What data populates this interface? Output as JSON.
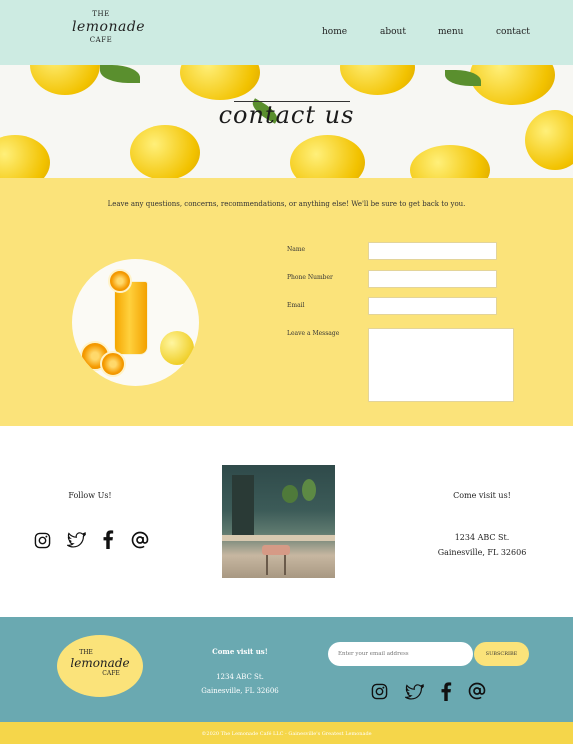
{
  "brand": {
    "the": "THE",
    "name": "lemonade",
    "cafe": "CAFE"
  },
  "nav": {
    "items": [
      "home",
      "about",
      "menu",
      "contact"
    ]
  },
  "hero": {
    "title": "contact us"
  },
  "contact": {
    "intro": "Leave any questions, concerns, recommendations, or anything else! We'll be sure to get back to you.",
    "fields": {
      "name_label": "Name",
      "phone_label": "Phone Number",
      "email_label": "Email",
      "message_label": "Leave a Message"
    }
  },
  "follow": {
    "title": "Follow Us!",
    "icons": [
      "instagram-icon",
      "twitter-icon",
      "facebook-icon",
      "at-icon"
    ]
  },
  "visit": {
    "title": "Come visit us!",
    "street": "1234 ABC St.",
    "city": "Gainesville, FL 32606"
  },
  "footer": {
    "visit_title": "Come visit us!",
    "street": "1234 ABC St.",
    "city": "Gainesville, FL 32606",
    "email_placeholder": "Enter your email address",
    "subscribe_label": "SUBSCRIBE",
    "copyright": "©2020 The Lemonade Café LLC - Gainesville's Greatest Lemonade"
  },
  "colors": {
    "header_bg": "#cdebe2",
    "yellow": "#fbe37a",
    "teal": "#6aa9b1",
    "bottom_bar": "#f5d64a"
  }
}
